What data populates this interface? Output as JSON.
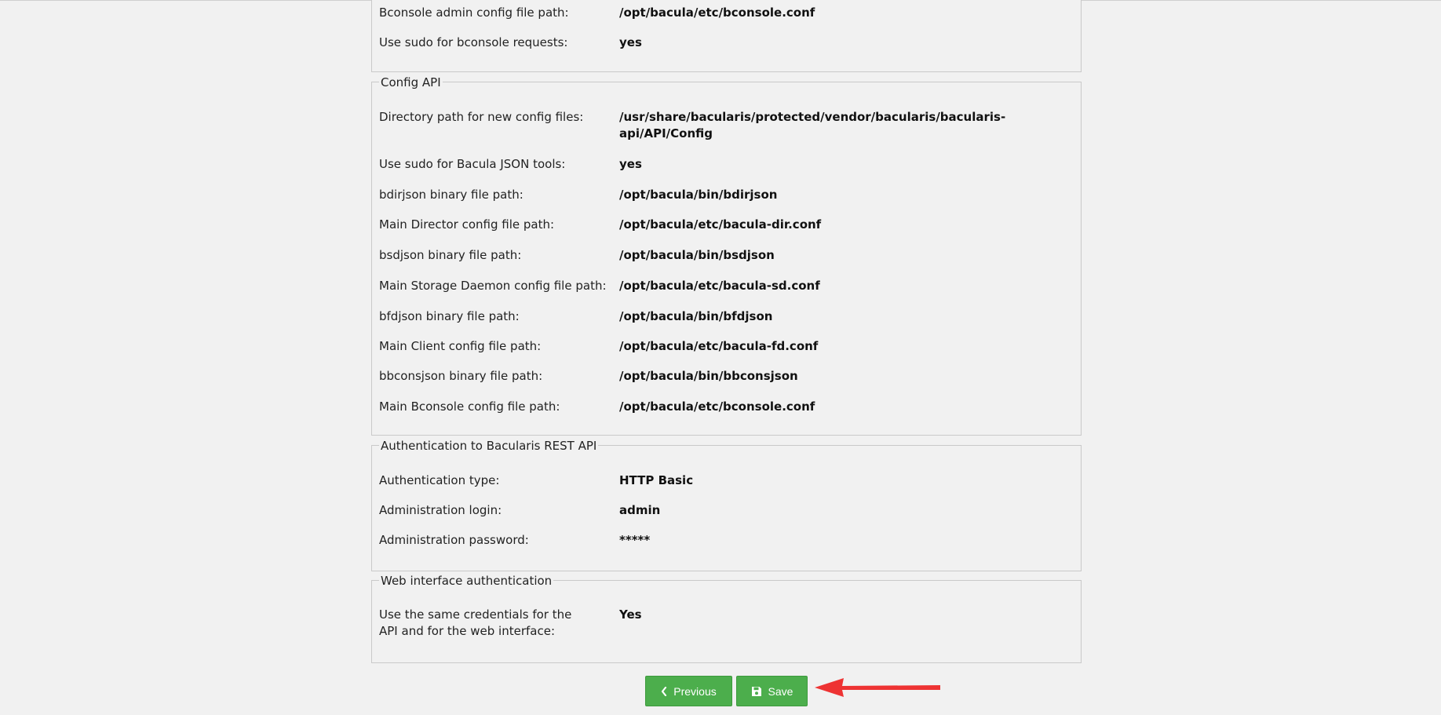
{
  "sections": {
    "bconsole": {
      "rows": [
        {
          "label": "Bconsole admin config file path:",
          "value": "/opt/bacula/etc/bconsole.conf"
        },
        {
          "label": "Use sudo for bconsole requests:",
          "value": "yes"
        }
      ]
    },
    "config_api": {
      "legend": "Config API",
      "rows": [
        {
          "label": "Directory path for new config files:",
          "value": "/usr/share/bacularis/protected/vendor/bacularis/bacularis-api/API/Config"
        },
        {
          "label": "Use sudo for Bacula JSON tools:",
          "value": "yes"
        },
        {
          "label": "bdirjson binary file path:",
          "value": "/opt/bacula/bin/bdirjson"
        },
        {
          "label": "Main Director config file path:",
          "value": "/opt/bacula/etc/bacula-dir.conf"
        },
        {
          "label": "bsdjson binary file path:",
          "value": "/opt/bacula/bin/bsdjson"
        },
        {
          "label": "Main Storage Daemon config file path:",
          "value": "/opt/bacula/etc/bacula-sd.conf"
        },
        {
          "label": "bfdjson binary file path:",
          "value": "/opt/bacula/bin/bfdjson"
        },
        {
          "label": "Main Client config file path:",
          "value": "/opt/bacula/etc/bacula-fd.conf"
        },
        {
          "label": "bbconsjson binary file path:",
          "value": "/opt/bacula/bin/bbconsjson"
        },
        {
          "label": "Main Bconsole config file path:",
          "value": "/opt/bacula/etc/bconsole.conf"
        }
      ]
    },
    "auth_api": {
      "legend": "Authentication to Bacularis REST API",
      "rows": [
        {
          "label": "Authentication type:",
          "value": "HTTP Basic"
        },
        {
          "label": "Administration login:",
          "value": "admin"
        },
        {
          "label": "Administration password:",
          "value": "*****"
        }
      ]
    },
    "web_auth": {
      "legend": "Web interface authentication",
      "rows": [
        {
          "label": "Use the same credentials for the API and for the web interface:",
          "value": "Yes"
        }
      ]
    }
  },
  "buttons": {
    "previous_label": "Previous",
    "save_label": "Save"
  },
  "icons": {
    "previous": "chevron-left-icon",
    "save": "floppy-disk-icon",
    "annotation": "red-arrow-icon"
  },
  "colors": {
    "button_bg": "#4cae4c",
    "annotation_arrow": "#ee3333",
    "page_bg": "#f1f1f1"
  }
}
